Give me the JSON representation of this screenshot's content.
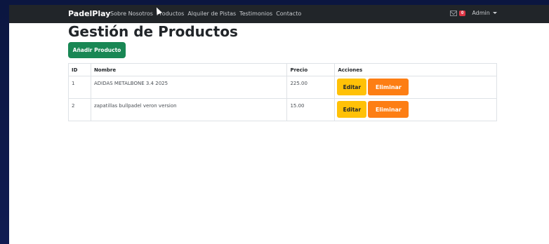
{
  "navbar": {
    "brand": "PadelPlay",
    "links": [
      "Sobre Nosotros",
      "Productos",
      "Alquiler de Pistas",
      "Testimonios",
      "Contacto"
    ],
    "notification_count": "0",
    "user_label": "Admin"
  },
  "main": {
    "title": "Gestión de Productos",
    "add_button": "Añadir Producto"
  },
  "table": {
    "headers": [
      "ID",
      "Nombre",
      "Precio",
      "Acciones"
    ],
    "rows": [
      {
        "id": "1",
        "name": "ADIDAS METALBONE 3.4 2025",
        "price": "225.00"
      },
      {
        "id": "2",
        "name": "zapatillas bullpadel veron version",
        "price": "15.00"
      }
    ],
    "edit_label": "Editar",
    "delete_label": "Eliminar"
  },
  "colors": {
    "navbar_bg": "#212529",
    "success": "#198754",
    "warning": "#ffc107",
    "orange": "#fd7e14",
    "danger": "#dc3545"
  }
}
